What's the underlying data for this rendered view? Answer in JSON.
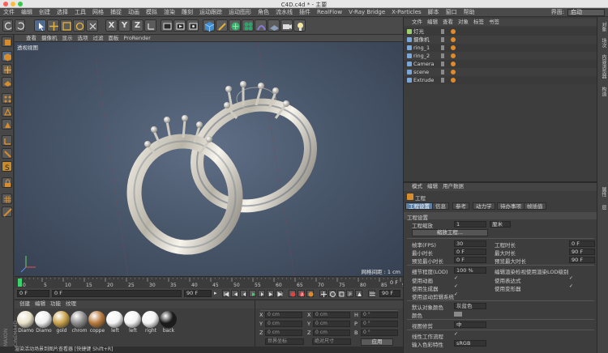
{
  "window": {
    "title": "C4D.c4d * - 主要"
  },
  "menubar": {
    "items": [
      "文件",
      "编辑",
      "创建",
      "选择",
      "工具",
      "网格",
      "捕捉",
      "动画",
      "模拟",
      "渲染",
      "雕刻",
      "运动跟踪",
      "运动图形",
      "角色",
      "流水线",
      "插件",
      "RealFlow",
      "V-Ray Bridge",
      "X-Particles",
      "脚本",
      "窗口",
      "帮助"
    ],
    "interface_label": "界面:",
    "interface_value": "启动"
  },
  "toolbar": {
    "icons": [
      "undo-icon",
      "redo-icon",
      "select-arrow-icon",
      "move-icon",
      "scale-icon",
      "rotate-icon",
      "recent-icon",
      "x-axis-icon",
      "y-axis-icon",
      "z-axis-icon",
      "coordinate-system-icon",
      "render-region-icon",
      "render-view-icon",
      "render-settings-icon",
      "cube-icon",
      "pen-icon",
      "subdivision-icon",
      "cloner-icon",
      "deformer-icon",
      "floor-icon",
      "camera-icon",
      "light-icon"
    ],
    "axis_labels": [
      "X",
      "Y",
      "Z"
    ]
  },
  "viewport": {
    "menu": [
      "查看",
      "摄像机",
      "显示",
      "选项",
      "过滤",
      "面板",
      "ProRender"
    ],
    "title": "透视视图",
    "grid_spacing_label": "网格间距 : 1 cm"
  },
  "timeline": {
    "ticks": [
      "0",
      "5",
      "10",
      "15",
      "20",
      "25",
      "30",
      "35",
      "40",
      "45",
      "50",
      "55",
      "60",
      "65",
      "70",
      "75",
      "80",
      "85",
      "90"
    ],
    "current_frame_label": "0 F",
    "start_field": "0 F",
    "current_field": "0 F",
    "end_field": "90 F",
    "end_field2": "90 F"
  },
  "materials": {
    "menu": [
      "创建",
      "编辑",
      "功能",
      "纹理"
    ],
    "items": [
      {
        "label": "Diamo",
        "color": "#e9e2c9"
      },
      {
        "label": "Diamo",
        "color": "#efefef"
      },
      {
        "label": "gold",
        "color": "#c9a24a"
      },
      {
        "label": "chrom",
        "color": "#8e8e8e"
      },
      {
        "label": "coppe",
        "color": "#b87a3c"
      },
      {
        "label": "left",
        "color": "#f4f4f4"
      },
      {
        "label": "left",
        "color": "#f4f4f4"
      },
      {
        "label": "right",
        "color": "#f4f4f4"
      },
      {
        "label": "back",
        "color": "#1a1a1a"
      }
    ]
  },
  "coordinates": {
    "rows": [
      {
        "axis": "X",
        "pos": "0 cm",
        "axis2": "X",
        "size": "0 cm",
        "axis3": "H",
        "rot": "0 °"
      },
      {
        "axis": "Y",
        "pos": "0 cm",
        "axis2": "Y",
        "size": "0 cm",
        "axis3": "P",
        "rot": "0 °"
      },
      {
        "axis": "Z",
        "pos": "0 cm",
        "axis2": "Z",
        "size": "0 cm",
        "axis3": "B",
        "rot": "0 °"
      }
    ],
    "coord_mode": "世界坐标",
    "size_mode": "绝对尺寸",
    "apply": "应用"
  },
  "status": "渲染活动场景到图片查看器 [快捷键 Shift+R]",
  "objects": {
    "menu": [
      "文件",
      "编辑",
      "查看",
      "对象",
      "标签",
      "书签"
    ],
    "rows": [
      {
        "name": "灯光",
        "color": "#9ccf6a"
      },
      {
        "name": "摄像机",
        "color": "#7aa7d9"
      },
      {
        "name": "ring_1",
        "color": "#7aa7d9"
      },
      {
        "name": "ring_2",
        "color": "#7aa7d9"
      },
      {
        "name": "Camera",
        "color": "#7aa7d9"
      },
      {
        "name": "scene",
        "color": "#7aa7d9"
      },
      {
        "name": "Extrude",
        "color": "#7aa7d9"
      }
    ]
  },
  "attributes": {
    "menu": [
      "模式",
      "编辑",
      "用户数据"
    ],
    "header": "工程",
    "tabs": [
      "工程设置",
      "信息",
      "参考",
      "动力学",
      "待办事项",
      "帧插值"
    ],
    "section": "工程设置",
    "project_scale_label": "工程缩放",
    "project_scale_value": "1",
    "project_scale_unit": "厘米",
    "scale_button": "缩放工程...",
    "fps_label": "帧率(FPS)",
    "fps_value": "30",
    "project_time_label": "工程时长",
    "project_time_value": "0 F",
    "min_time_label": "最小时长",
    "min_time_value": "0 F",
    "max_time_label": "最大时长",
    "max_time_value": "90 F",
    "preview_min_label": "预览最小时长",
    "preview_min_value": "0 F",
    "preview_max_label": "预览最大时长",
    "preview_max_value": "90 F",
    "lod_label": "细节程度(LOD)",
    "lod_value": "100 %",
    "lod_check_label": "编辑渲染检视使用渲染LOD级别",
    "use_anim": "使用动画",
    "use_expr": "使用表达式",
    "use_gen": "使用生成器",
    "use_deform": "使用变形器",
    "use_motion": "使用运动剪辑系统",
    "default_color_label": "默认对象颜色",
    "default_color_value": "灰蓝色",
    "color_label": "颜色",
    "view_clip_label": "视图修剪",
    "view_clip_value": "中",
    "linear_label": "线性工作流程",
    "input_color_label": "输入色彩特性",
    "input_color_value": "sRGB"
  },
  "right_strip_tabs": [
    "对象",
    "场次",
    "内容浏览器",
    "构造",
    "属性",
    "层"
  ]
}
